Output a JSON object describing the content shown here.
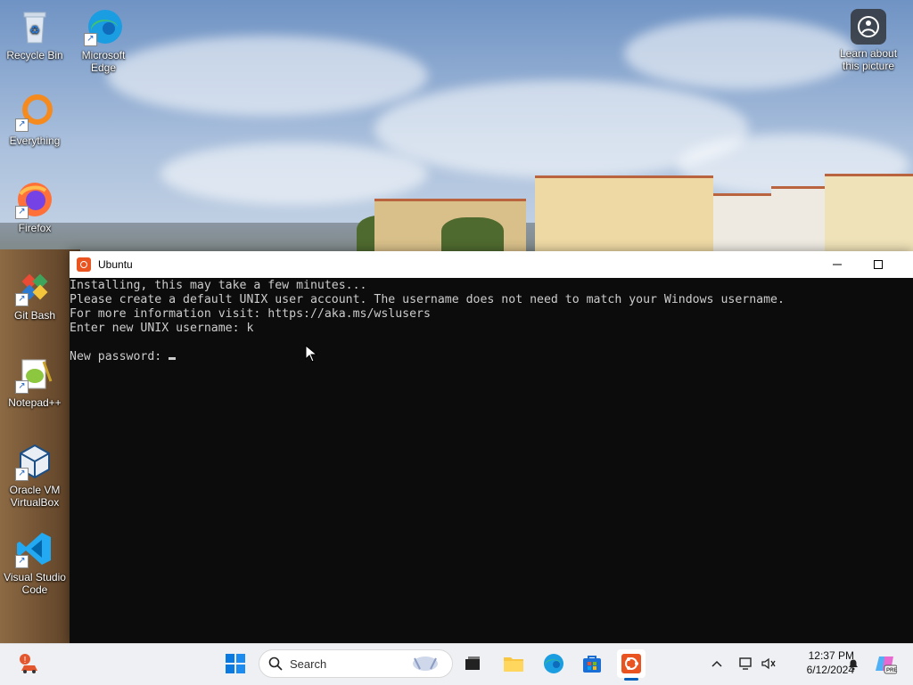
{
  "desktop": {
    "icons": [
      {
        "label": "Recycle Bin"
      },
      {
        "label": "Microsoft Edge"
      },
      {
        "label": "Everything"
      },
      {
        "label": "Firefox"
      },
      {
        "label": "Git Bash"
      },
      {
        "label": "Notepad++"
      },
      {
        "label": "Oracle VM VirtualBox"
      },
      {
        "label": "Visual Studio Code"
      }
    ],
    "learn_about": "Learn about this picture"
  },
  "window": {
    "title": "Ubuntu",
    "lines": [
      "Installing, this may take a few minutes...",
      "Please create a default UNIX user account. The username does not need to match your Windows username.",
      "For more information visit: https://aka.ms/wslusers",
      "Enter new UNIX username: k",
      "",
      "New password: "
    ]
  },
  "taskbar": {
    "search_placeholder": "Search",
    "clock_time": "12:37 PM",
    "clock_date": "6/12/2024",
    "copilot_badge": "PRE"
  }
}
